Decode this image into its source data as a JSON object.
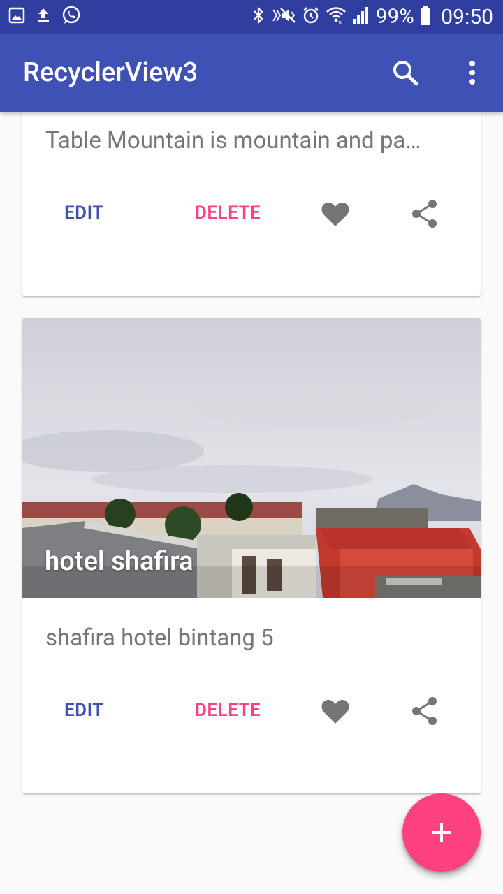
{
  "status_bar": {
    "battery": "99%",
    "time": "09:50",
    "left_icons": [
      "gallery-icon",
      "upload-icon",
      "whatsapp-icon"
    ],
    "right_icons": [
      "bluetooth-icon",
      "mute-icon",
      "alarm-icon",
      "wifi-icon",
      "signal-icon",
      "battery-icon"
    ]
  },
  "app_bar": {
    "title": "RecyclerView3",
    "actions": [
      "search-icon",
      "more-vert-icon"
    ]
  },
  "cards": [
    {
      "description": "Table Mountain is mountain and pa…",
      "edit_label": "EDIT",
      "delete_label": "DELETE"
    },
    {
      "title": "hotel shafira",
      "description": "shafira hotel bintang 5",
      "edit_label": "EDIT",
      "delete_label": "DELETE"
    }
  ],
  "fab": {
    "icon": "add-icon"
  },
  "colors": {
    "primary": "#3f51b5",
    "primary_dark": "#303f9f",
    "accent": "#ff4081",
    "icon_grey": "#757575"
  }
}
